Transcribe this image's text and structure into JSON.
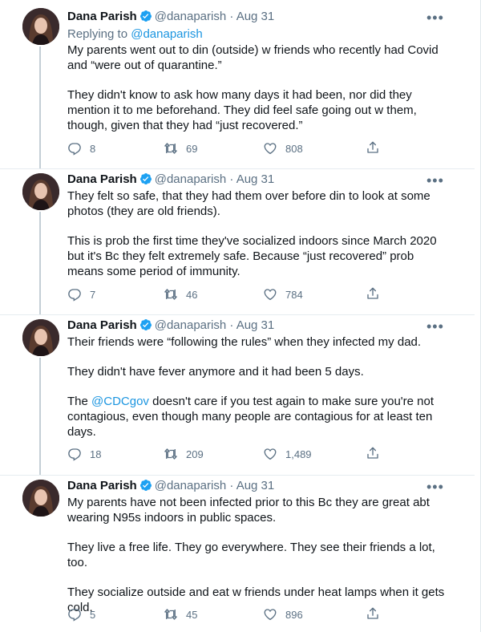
{
  "tweets": [
    {
      "name": "Dana Parish",
      "handle": "@danaparish",
      "date": "Aug 31",
      "replying_prefix": "Replying to ",
      "replying_handle": "@danaparish",
      "paragraphs": [
        "My parents went out to din (outside) w friends who recently had Covid and “were out of quarantine.”",
        "They didn't know to ask how many days it had been, nor did they mention it to me beforehand. They did feel safe going out w them, though, given that they had “just recovered.”"
      ],
      "replies": "8",
      "retweets": "69",
      "likes": "808"
    },
    {
      "name": "Dana Parish",
      "handle": "@danaparish",
      "date": "Aug 31",
      "paragraphs": [
        "They felt so safe, that they had them over before din to look at some photos (they are old friends).",
        "This is prob the first time they've socialized indoors since March 2020 but it's Bc they felt extremely safe. Because “just recovered” prob means some period of immunity."
      ],
      "replies": "7",
      "retweets": "46",
      "likes": "784"
    },
    {
      "name": "Dana Parish",
      "handle": "@danaparish",
      "date": "Aug 31",
      "paragraphs": [
        "Their friends were “following the rules” when they infected my dad.",
        "They didn't have fever anymore and it had been 5 days."
      ],
      "p3_before": "The ",
      "p3_mention": "@CDCgov",
      "p3_after": " doesn't care if you test again to make sure you're not contagious, even though many people are contagious for at least ten days.",
      "replies": "18",
      "retweets": "209",
      "likes": "1,489"
    },
    {
      "name": "Dana Parish",
      "handle": "@danaparish",
      "date": "Aug 31",
      "paragraphs": [
        "My parents have not been infected prior to this Bc they are great abt wearing N95s indoors in public spaces.",
        "They live a free life. They go everywhere. They see their friends a lot, too.",
        "They socialize outside and eat w friends under heat lamps when it gets cold."
      ],
      "replies": "5",
      "retweets": "45",
      "likes": "896"
    }
  ],
  "separator": "·",
  "icons": {
    "verified": "verified-badge-icon",
    "more": "more-options-icon",
    "reply": "reply-icon",
    "retweet": "retweet-icon",
    "like": "like-heart-icon",
    "share": "share-icon"
  },
  "colors": {
    "link": "#1b95e0",
    "muted": "#5b7083",
    "verified": "#1da1f2",
    "thread_line": "#c4cfd6"
  }
}
